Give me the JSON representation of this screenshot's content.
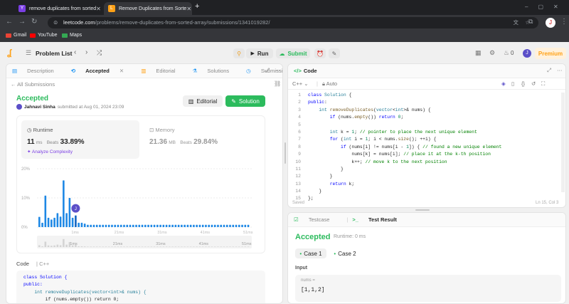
{
  "browser": {
    "tabs": [
      {
        "title": "remove duplicates from sorted",
        "active": false
      },
      {
        "title": "Remove Duplicates from Sorte",
        "active": true
      }
    ],
    "url_host": "leetcode.com",
    "url_path": "/problems/remove-duplicates-from-sorted-array/submissions/1341019282/",
    "bookmarks": [
      "Gmail",
      "YouTube",
      "Maps"
    ],
    "profile_initial": "J"
  },
  "nav": {
    "problem_list": "Problem List",
    "run": "Run",
    "submit": "Submit",
    "streak": "0",
    "premium": "Premium",
    "avatar": "J"
  },
  "left_tabs": [
    "Description",
    "Accepted",
    "Editorial",
    "Solutions",
    "Submissions"
  ],
  "submission": {
    "all_submissions": "All Submissions",
    "status": "Accepted",
    "author": "Jahnavi Sinha",
    "submitted_at": "submitted at Aug 01, 2024 23:09",
    "editorial_btn": "Editorial",
    "solution_btn": "Solution",
    "runtime_label": "Runtime",
    "runtime_value": "11",
    "runtime_unit": "ms",
    "beats_label": "Beats",
    "runtime_beats": "33.89%",
    "analyze": "Analyze Complexity",
    "memory_label": "Memory",
    "memory_value": "21.36",
    "memory_unit": "MB",
    "memory_beats": "29.84%",
    "code_label": "Code",
    "code_lang": "C++",
    "code_preview": [
      "class Solution {",
      "public:",
      "    int removeDuplicates(vector<int>& nums) {",
      "        if (nums.empty()) return 0;"
    ]
  },
  "chart_data": {
    "type": "bar",
    "y_ticks": [
      "20%",
      "10%",
      "0%"
    ],
    "x_ticks": [
      "1ms",
      "21ms",
      "31ms",
      "41ms",
      "51ms"
    ],
    "mini_x_ticks": [
      "1ms",
      "21ms",
      "31ms",
      "41ms",
      "51ms"
    ],
    "ylim": [
      0,
      20
    ],
    "values": [
      3.5,
      1.5,
      10.8,
      3.2,
      2.6,
      3.2,
      4.8,
      3.6,
      16,
      4.8,
      10,
      3.2,
      4,
      1.5,
      1.5,
      1.2,
      0.8,
      0.8,
      0.8,
      0.8,
      0.8,
      0.8,
      0.8,
      0.8,
      0.8,
      0.8,
      0.8,
      0.8,
      0.8,
      0.8,
      0.8,
      0.8,
      0.8,
      0.8,
      0.8,
      0.8,
      0.8,
      0.8,
      0.8,
      0.8,
      0.8,
      0.8,
      0.8,
      0.8,
      0.8,
      0.8,
      0.8,
      0.8,
      0.8,
      0.8,
      0.8,
      0.8,
      0.8,
      0.8,
      0.8,
      0.8,
      0.8,
      0.8,
      0.8,
      0.8,
      0.8,
      0.8,
      0.8,
      0.8,
      0.8,
      0.8,
      0.8,
      0.8,
      0.8,
      0.8
    ],
    "highlight_index": 12,
    "marker_label": "J",
    "colors": {
      "bar": "#1e88e5",
      "marker": "#5b4fc8"
    }
  },
  "editor": {
    "title": "Code",
    "lang": "C++",
    "auto": "Auto",
    "status_left": "Saved",
    "status_right": "Ln 15, Col 3",
    "lines": [
      "class Solution {",
      "public:",
      "    int removeDuplicates(vector<int>& nums) {",
      "        if (nums.empty()) return 0;",
      "",
      "        int k = 1; // pointer to place the next unique element",
      "        for (int i = 1; i < nums.size(); ++i) {",
      "            if (nums[i] != nums[i - 1]) { // found a new unique element",
      "                nums[k] = nums[i]; // place it at the k-th position",
      "                k++; // move k to the next position",
      "            }",
      "        }",
      "        return k;",
      "    }",
      "};"
    ]
  },
  "test": {
    "tab_testcase": "Testcase",
    "tab_result": "Test Result",
    "status": "Accepted",
    "runtime": "Runtime: 0 ms",
    "case1": "Case 1",
    "case2": "Case 2",
    "input_label": "Input",
    "var_name": "nums =",
    "var_value": "[1,1,2]"
  },
  "colors": {
    "accent_green": "#2cbb5d",
    "accent_orange": "#ffa116",
    "link_blue": "#007aff"
  }
}
